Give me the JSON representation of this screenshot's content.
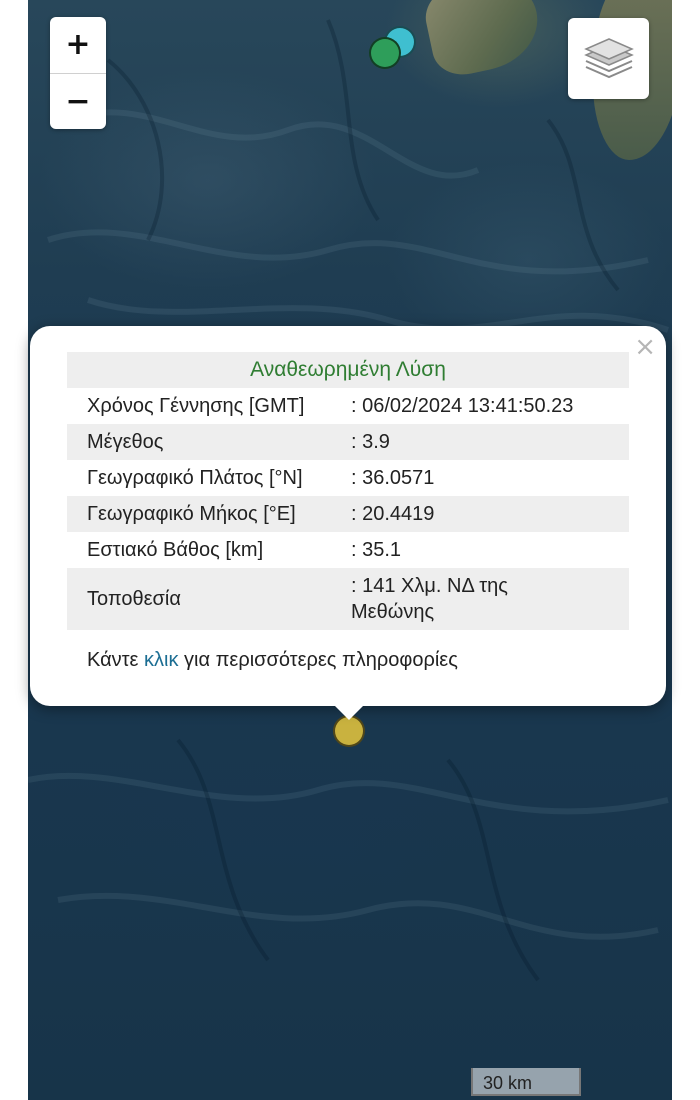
{
  "map": {
    "zoom_in_label": "+",
    "zoom_out_label": "−",
    "layers_icon": "layers-icon",
    "markers": [
      {
        "color": "#3fbfd0"
      },
      {
        "color": "#2e9e5a"
      },
      {
        "color": "#c9b23f"
      }
    ],
    "scale_label": "30 km"
  },
  "popup": {
    "title": "Αναθεωρημένη Λύση",
    "close_label": "×",
    "rows": [
      {
        "label": "Χρόνος Γέννησης [GMT]",
        "value": ": 06/02/2024 13:41:50.23"
      },
      {
        "label": "Μέγεθος",
        "value": ": 3.9"
      },
      {
        "label": "Γεωγραφικό Πλάτος [°N]",
        "value": ": 36.0571"
      },
      {
        "label": "Γεωγραφικό Μήκος [°E]",
        "value": ": 20.4419"
      },
      {
        "label": "Εστιακό Βάθος [km]",
        "value": ": 35.1"
      },
      {
        "label": "Τοποθεσία",
        "value": ": 141 Χλμ. ΝΔ της Μεθώνης"
      }
    ],
    "more_prefix": "Κάντε ",
    "more_link": "κλικ",
    "more_suffix": " για περισσότερες πληροφορίες",
    "title_color": "#2f7d32",
    "link_color": "#1c6e93"
  }
}
